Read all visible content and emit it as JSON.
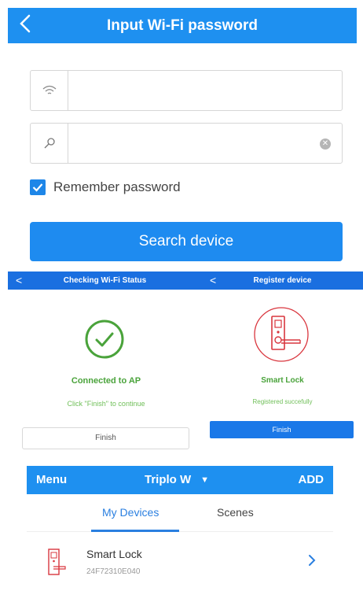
{
  "wifi_screen": {
    "title": "Input Wi-Fi password",
    "remember_label": "Remember password",
    "remember_checked": true,
    "search_button": "Search device",
    "ssid_value": "",
    "password_value": ""
  },
  "status_screen": {
    "title": "Checking Wi-Fi Status",
    "status": "Connected to AP",
    "hint": "Click \"Finish\" to continue",
    "finish": "Finish"
  },
  "register_screen": {
    "title": "Register device",
    "device_name": "Smart Lock",
    "message": "Registered succefully",
    "finish": "Finish"
  },
  "devices_screen": {
    "menu": "Menu",
    "home_name": "Triplo W",
    "add": "ADD",
    "tabs": [
      "My Devices",
      "Scenes"
    ],
    "devices": [
      {
        "name": "Smart Lock",
        "id": "24F72310E040"
      }
    ]
  },
  "colors": {
    "accent": "#1e90f0",
    "success": "#4aa33b",
    "lock_red": "#d9363e"
  }
}
